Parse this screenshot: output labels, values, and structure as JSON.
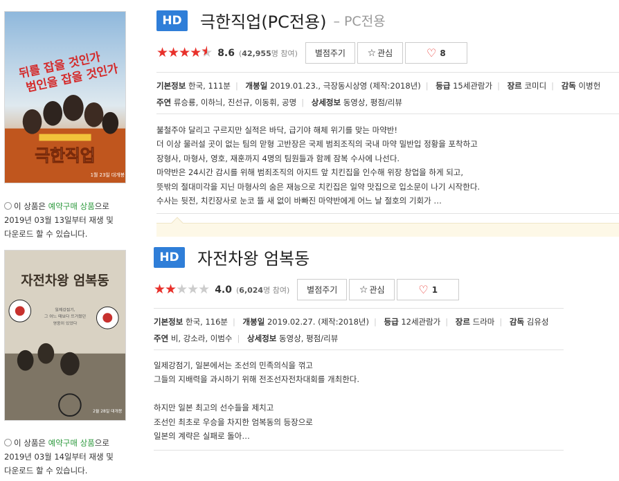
{
  "movies": [
    {
      "badge": "HD",
      "title": "극한직업(PC전용)",
      "subtitle": "– PC전용",
      "rating": 4.3,
      "score": "8.6",
      "votes_open": "(",
      "votes_count": "42,955",
      "votes_suffix": "명 참여)",
      "rate_button": "별점주기",
      "fav_button": "관심",
      "like_count": "8",
      "info_row1": [
        {
          "label": "기본정보",
          "value": "한국, 111분"
        },
        {
          "label": "개봉일",
          "value": "2019.01.23., 극장동시상영 (제작:2018년)"
        },
        {
          "label": "등급",
          "value": "15세관람가"
        },
        {
          "label": "장르",
          "value": "코미디"
        },
        {
          "label": "감독",
          "value": "이병헌"
        }
      ],
      "info_row2": [
        {
          "label": "주연",
          "value": "류승룡, 이하늬, 진선규, 이동휘, 공명"
        },
        {
          "label": "상세정보",
          "value": "동영상, 평점/리뷰"
        }
      ],
      "synopsis": [
        "불철주야 달리고 구르지만 실적은 바닥, 급기야 해체 위기를 맞는 마약반!",
        "더 이상 물러설 곳이 없는 팀의 맏형 고반장은 국제 범죄조직의 국내 마약 밀반입 정황을 포착하고",
        "장형사, 마형사, 영호, 재훈까지 4명의 팀원들과 함께 잠복 수사에 나선다.",
        "마약반은 24시간 감시를 위해 범죄조직의 아지트 앞 치킨집을 인수해 위장 창업을 하게 되고,",
        "뜻밖의 절대미각을 지닌 마형사의 숨은 재능으로 치킨집은 일약 맛집으로 입소문이 나기 시작한다.",
        "수사는 뒷전, 치킨장사로 눈코 뜰 새 없이 바빠진 마약반에게 어느 날 절호의 기회가 …"
      ],
      "notice": {
        "prefix": "이 상품은 ",
        "highlight": "예약구매 상품",
        "suffix": "으로",
        "line2": "2019년 03월 13일부터 재생 및",
        "line3": "다운로드 할 수 있습니다."
      },
      "poster": {
        "tagline1": "뒤를 잡을 것인가",
        "tagline2": "범인을 잡을 것인가",
        "title": "극한직업",
        "release": "1월 23일 대개봉"
      }
    },
    {
      "badge": "HD",
      "title": "자전차왕 엄복동",
      "subtitle": "",
      "rating": 2.0,
      "score": "4.0",
      "votes_open": "(",
      "votes_count": "6,024",
      "votes_suffix": "명 참여)",
      "rate_button": "별점주기",
      "fav_button": "관심",
      "like_count": "1",
      "info_row1": [
        {
          "label": "기본정보",
          "value": "한국, 116분"
        },
        {
          "label": "개봉일",
          "value": "2019.02.27. (제작:2018년)"
        },
        {
          "label": "등급",
          "value": "12세관람가"
        },
        {
          "label": "장르",
          "value": "드라마"
        },
        {
          "label": "감독",
          "value": "김유성"
        }
      ],
      "info_row2": [
        {
          "label": "주연",
          "value": "비, 강소라, 이범수"
        },
        {
          "label": "상세정보",
          "value": "동영상, 평점/리뷰"
        }
      ],
      "synopsis": [
        "일제강점기, 일본에서는 조선의 민족의식을 꺾고",
        "그들의 지배력을 과시하기 위해 전조선자전차대회를 개최한다.",
        "",
        "하지만 일본 최고의 선수들을 제치고",
        "조선인 최초로 우승을 차지한 엄복동의 등장으로",
        "일본의 계략은 실패로 돌아…"
      ],
      "notice": {
        "prefix": "이 상품은 ",
        "highlight": "예약구매 상품",
        "suffix": "으로",
        "line2": "2019년 03월 14일부터 재생 및",
        "line3": "다운로드 할 수 있습니다."
      },
      "poster": {
        "title": "자전차왕 엄복동",
        "quote1": "일제강점기,",
        "quote2": "그 어느 때보다 뜨거웠던",
        "quote3": "영웅이 있었다",
        "release": "2월 28일 대개봉"
      }
    }
  ],
  "colors": {
    "hd": "#2f7ed8",
    "star_on": "#e8312b",
    "heart": "#e8312b",
    "highlight": "#2e9a3e"
  }
}
